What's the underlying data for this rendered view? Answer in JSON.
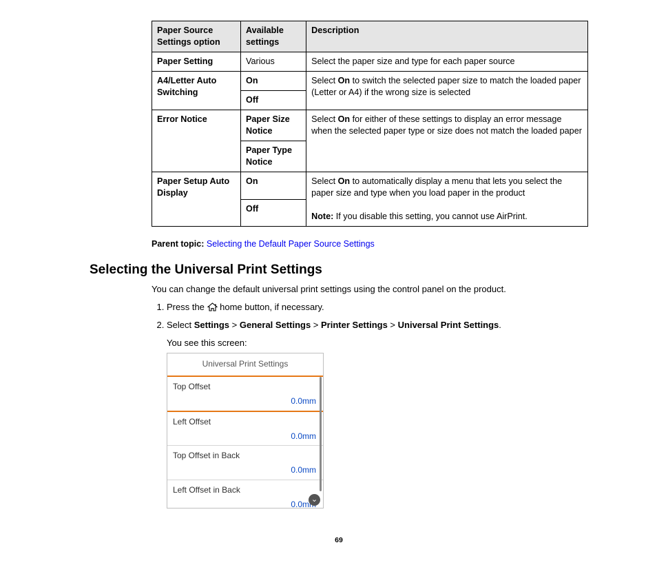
{
  "table": {
    "headers": [
      "Paper Source Settings option",
      "Available settings",
      "Description"
    ],
    "rows": [
      {
        "option": "Paper Setting",
        "settings": [
          "Various"
        ],
        "description": "Select the paper size and type for each paper source"
      },
      {
        "option": "A4/Letter Auto Switching",
        "settings": [
          "On",
          "Off"
        ],
        "description_pre": "Select ",
        "description_bold": "On",
        "description_post": " to switch the selected paper size to match the loaded paper (Letter or A4) if the wrong size is selected"
      },
      {
        "option": "Error Notice",
        "settings": [
          "Paper Size Notice",
          "Paper Type Notice"
        ],
        "description_pre": "Select ",
        "description_bold": "On",
        "description_post": " for either of these settings to display an error message when the selected paper type or size does not match the loaded paper"
      },
      {
        "option": "Paper Setup Auto Display",
        "settings": [
          "On",
          "Off"
        ],
        "description_pre": "Select ",
        "description_bold": "On",
        "description_post": " to automatically display a menu that lets you select the paper size and type when you load paper in the product",
        "note_label": "Note:",
        "note_text": " If you disable this setting, you cannot use AirPrint."
      }
    ]
  },
  "parent_topic": {
    "label": "Parent topic:",
    "link": "Selecting the Default Paper Source Settings"
  },
  "section_title": "Selecting the Universal Print Settings",
  "intro": "You can change the default universal print settings using the control panel on the product.",
  "steps": {
    "s1_pre": "Press the ",
    "s1_post": " home button, if necessary.",
    "s2_pre": "Select ",
    "s2_b1": "Settings",
    "s2_b2": "General Settings",
    "s2_b3": "Printer Settings",
    "s2_b4": "Universal Print Settings",
    "s2_sep": " > ",
    "s2_end": ".",
    "s2_after": "You see this screen:"
  },
  "device": {
    "title": "Universal Print Settings",
    "rows": [
      {
        "label": "Top Offset",
        "value": "0.0mm",
        "highlight": true
      },
      {
        "label": "Left Offset",
        "value": "0.0mm"
      },
      {
        "label": "Top Offset in Back",
        "value": "0.0mm"
      },
      {
        "label": "Left Offset in Back",
        "value": "0.0mm",
        "last": true
      }
    ]
  },
  "page_number": "69"
}
